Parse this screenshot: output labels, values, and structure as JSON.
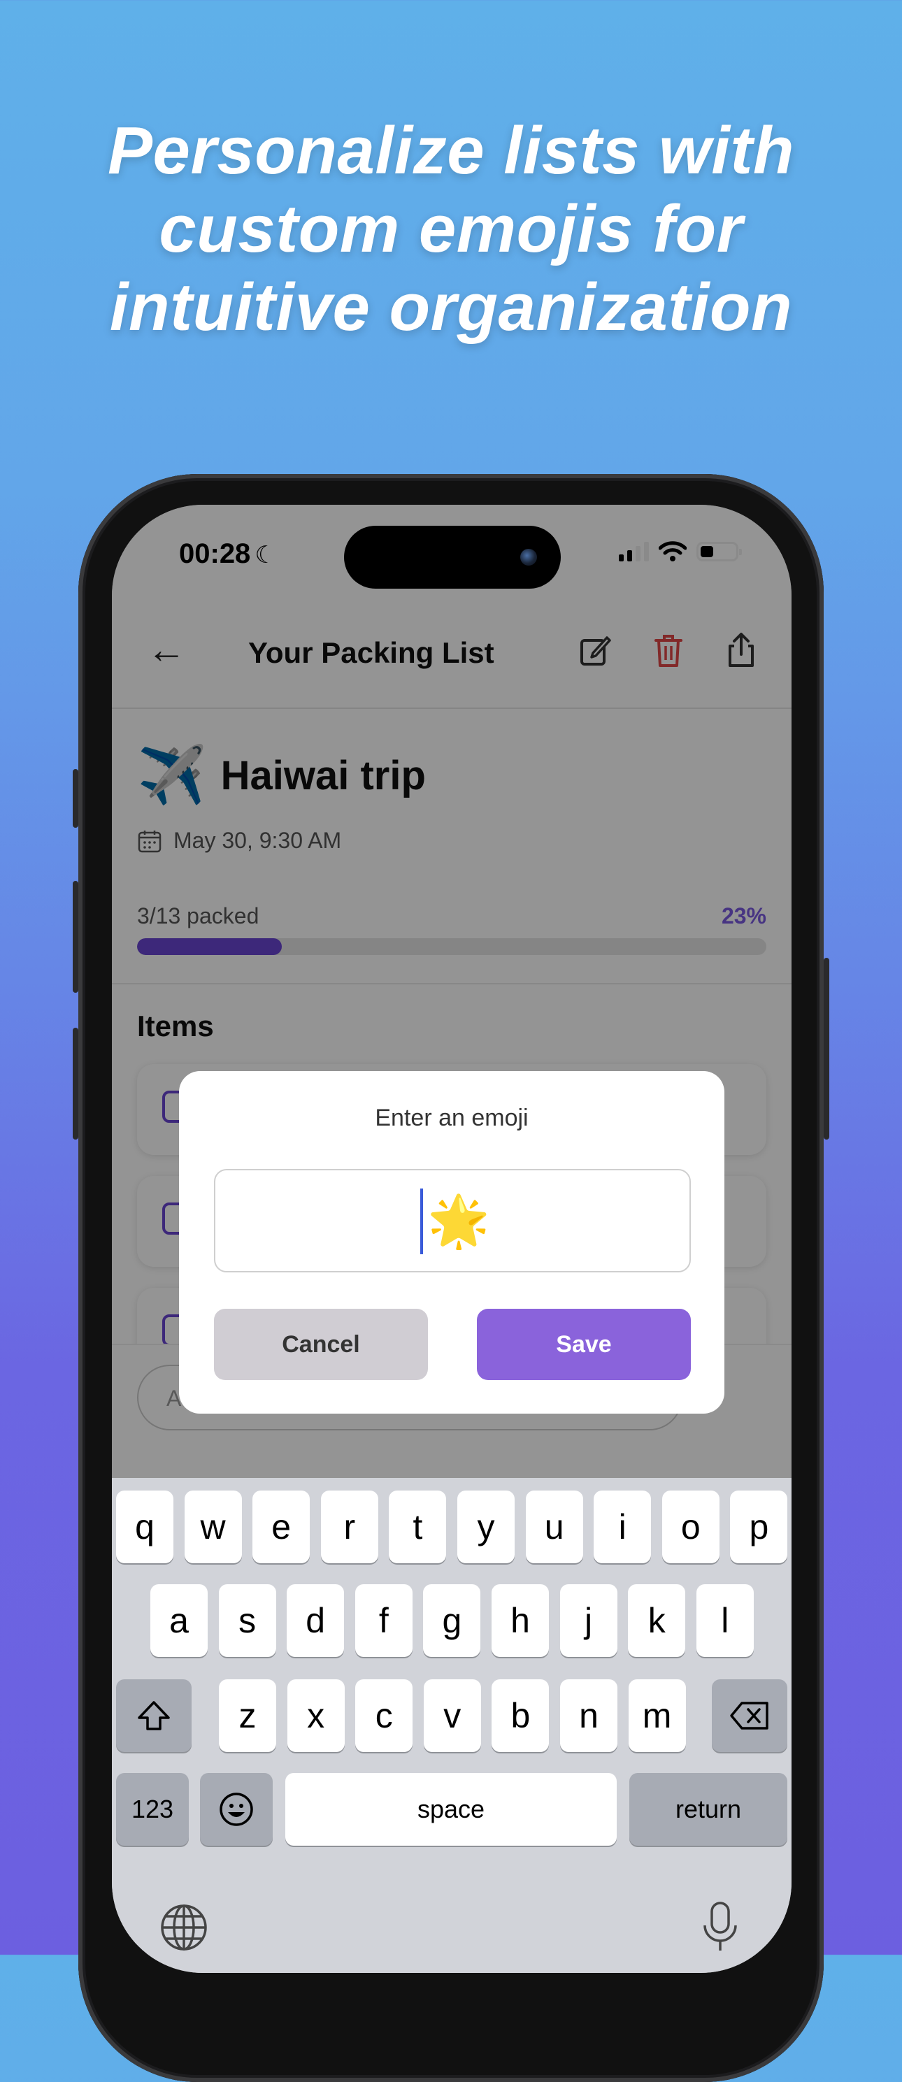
{
  "headline": {
    "line1": "Personalize lists with",
    "line2": "custom emojis for",
    "line3": "intuitive organization"
  },
  "status_bar": {
    "time": "00:28",
    "moon_icon": "moon-icon",
    "battery_level": 0.3
  },
  "app_header": {
    "title": "Your Packing List",
    "icons": [
      "back-arrow-icon",
      "edit-icon",
      "trash-icon",
      "share-icon"
    ],
    "trash_color": "#e04848"
  },
  "trip": {
    "emoji": "✈️",
    "name": "Haiwai trip",
    "date": "May 30, 9:30 AM"
  },
  "progress": {
    "label": "3/13 packed",
    "percent_text": "23%",
    "fraction": 0.23
  },
  "items_section": {
    "title": "Items"
  },
  "dialog": {
    "title": "Enter an emoji",
    "input_value": "🌟",
    "cancel_label": "Cancel",
    "save_label": "Save"
  },
  "keyboard": {
    "row1": [
      "q",
      "w",
      "e",
      "r",
      "t",
      "y",
      "u",
      "i",
      "o",
      "p"
    ],
    "row2": [
      "a",
      "s",
      "d",
      "f",
      "g",
      "h",
      "j",
      "k",
      "l"
    ],
    "row3": [
      "z",
      "x",
      "c",
      "v",
      "b",
      "n",
      "m"
    ],
    "numbers_label": "123",
    "space_label": "space",
    "return_label": "return"
  },
  "colors": {
    "accent": "#6a46d2",
    "save_button": "#8a63db",
    "cancel_button": "#d0cdd3"
  }
}
